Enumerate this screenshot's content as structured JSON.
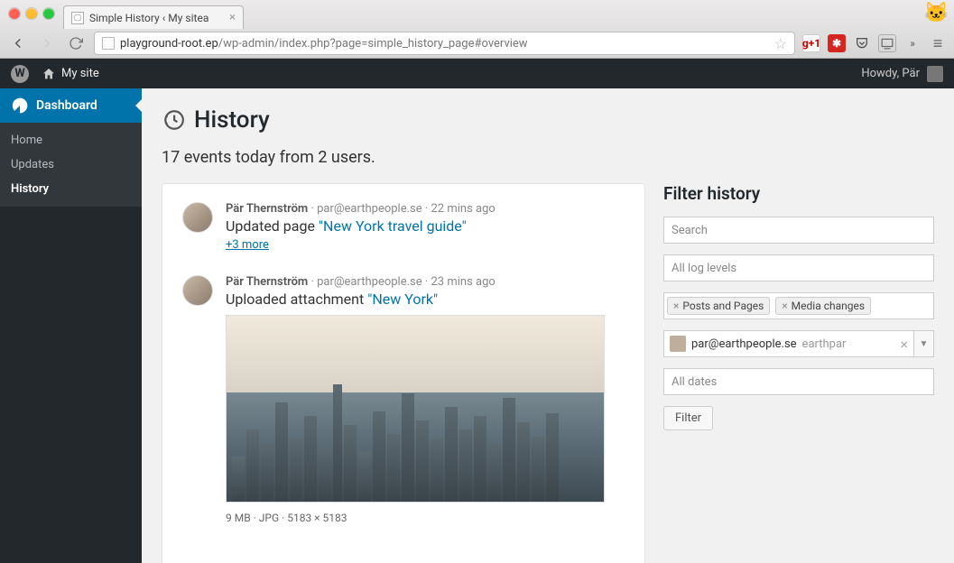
{
  "browser": {
    "tab_title": "Simple History ‹ My sitea",
    "url_host": "playground-root.ep",
    "url_path": "/wp-admin/index.php?page=simple_history_page#overview"
  },
  "wpbar": {
    "site_name": "My site",
    "howdy": "Howdy, Pär"
  },
  "menu": {
    "dashboard": "Dashboard",
    "items": [
      "Home",
      "Updates",
      "History"
    ],
    "current": "History"
  },
  "page": {
    "title": "History",
    "summary": "17 events today from 2 users."
  },
  "events": [
    {
      "author": "Pär Thernström",
      "email": "par@earthpeople.se",
      "time": "22 mins ago",
      "action_pre": "Updated page ",
      "link": "\"New York travel guide\"",
      "more": "+3 more"
    },
    {
      "author": "Pär Thernström",
      "email": "par@earthpeople.se",
      "time": "23 mins ago",
      "action_pre": "Uploaded attachment ",
      "link": "\"New York\"",
      "attachment_info": "9 MB · JPG · 5183 × 5183"
    }
  ],
  "filter": {
    "heading": "Filter history",
    "search_placeholder": "Search",
    "levels_placeholder": "All log levels",
    "tags": [
      "Posts and Pages",
      "Media changes"
    ],
    "user_email": "par@earthpeople.se",
    "user_extra": "earthpar",
    "dates_placeholder": "All dates",
    "button": "Filter"
  }
}
